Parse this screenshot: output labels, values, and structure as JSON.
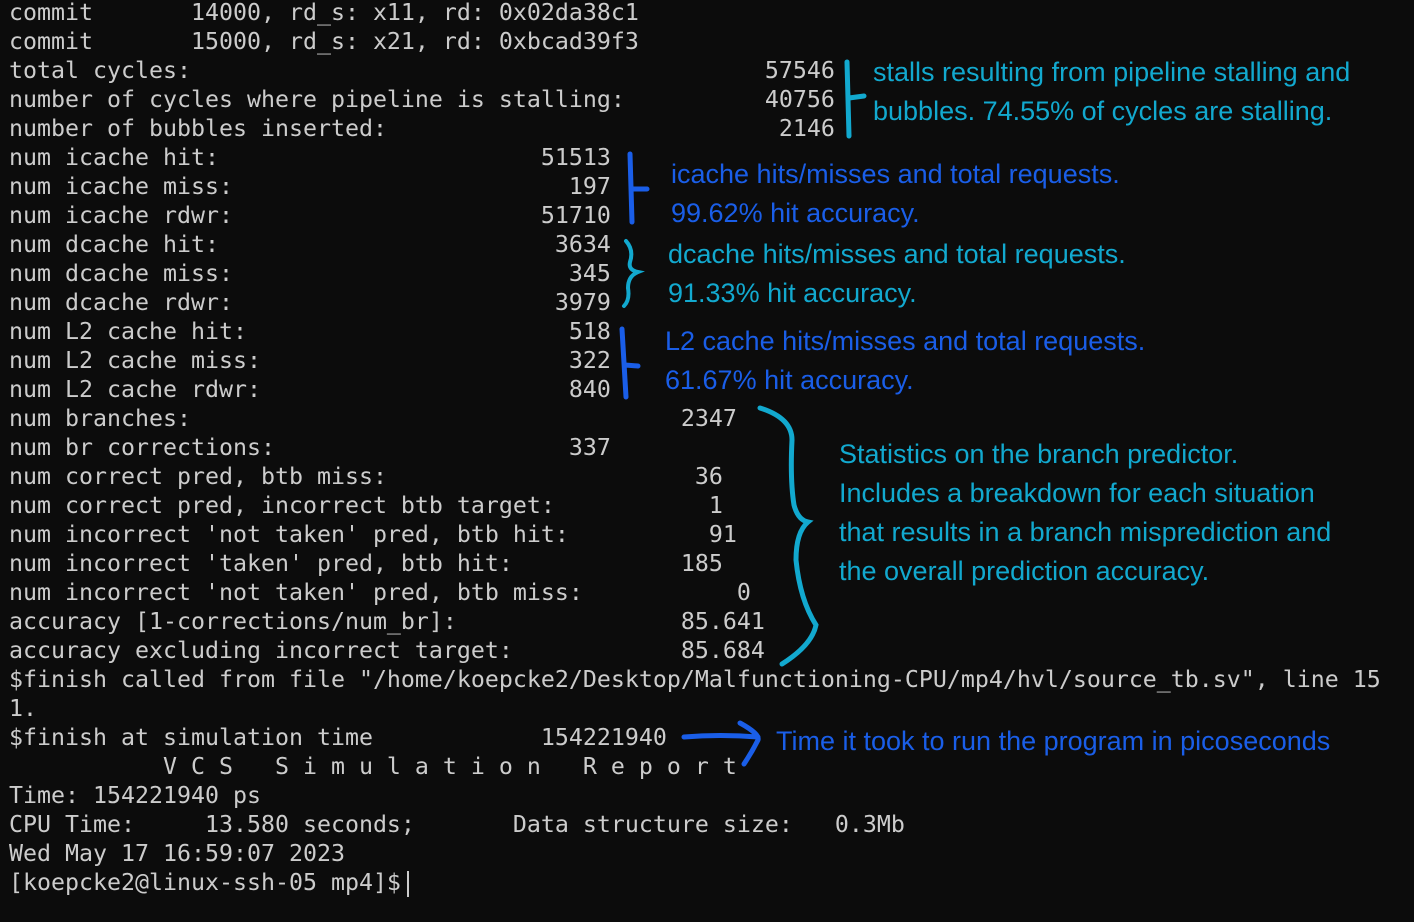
{
  "terminal": {
    "lines": [
      "commit       14000, rd_s: x11, rd: 0x02da38c1",
      "commit       15000, rd_s: x21, rd: 0xbcad39f3",
      "total cycles:                                         57546",
      "number of cycles where pipeline is stalling:          40756",
      "number of bubbles inserted:                            2146",
      "num icache hit:                       51513",
      "num icache miss:                        197",
      "num icache rdwr:                      51710",
      "num dcache hit:                        3634",
      "num dcache miss:                        345",
      "num dcache rdwr:                       3979",
      "num L2 cache hit:                       518",
      "num L2 cache miss:                      322",
      "num L2 cache rdwr:                      840",
      "num branches:                                   2347",
      "num br corrections:                     337",
      "num correct pred, btb miss:                      36",
      "num correct pred, incorrect btb target:           1",
      "num incorrect 'not taken' pred, btb hit:          91",
      "num incorrect 'taken' pred, btb hit:            185",
      "num incorrect 'not taken' pred, btb miss:           0",
      "accuracy [1-corrections/num_br]:                85.641",
      "accuracy excluding incorrect target:            85.684",
      "$finish called from file \"/home/koepcke2/Desktop/Malfunctioning-CPU/mp4/hvl/source_tb.sv\", line 15",
      "1.",
      "$finish at simulation time            154221940",
      "           V C S   S i m u l a t i o n   R e p o r t",
      "Time: 154221940 ps",
      "CPU Time:     13.580 seconds;       Data structure size:   0.3Mb",
      "Wed May 17 16:59:07 2023"
    ],
    "prompt": "[koepcke2@linux-ssh-05 mp4]$"
  },
  "annotations": {
    "stalls": [
      "stalls resulting from pipeline stalling and",
      "bubbles. 74.55% of cycles are stalling."
    ],
    "icache": [
      "icache hits/misses and total requests.",
      "99.62% hit accuracy."
    ],
    "dcache": [
      "dcache hits/misses and total requests.",
      "91.33% hit accuracy."
    ],
    "l2": [
      "L2 cache hits/misses and total requests.",
      "61.67% hit accuracy."
    ],
    "branch": [
      "Statistics on the branch predictor.",
      "Includes a breakdown for each situation",
      "that results in a branch misprediction and",
      "the overall prediction accuracy."
    ],
    "time": "Time it took to run the program in picoseconds"
  },
  "colors": {
    "background": "#0c0c0c",
    "text": "#cccccc",
    "cyan": "#12a9cf",
    "blue": "#1a5ee8"
  }
}
